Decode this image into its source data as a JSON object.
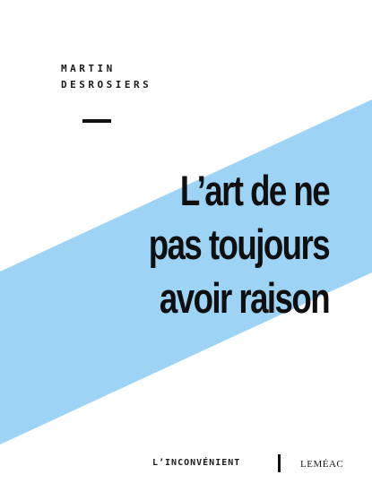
{
  "cover": {
    "author": {
      "first_name": "MARTIN",
      "last_name": "DESROSIERS"
    },
    "title_lines": [
      "L’art de ne",
      "pas toujours",
      "avoir raison"
    ],
    "collection": "L’INCONVÉNIENT",
    "publisher": "LEMÉAC",
    "colors": {
      "background": "#ffffff",
      "band": "#9dd3f5",
      "text": "#111111"
    }
  }
}
